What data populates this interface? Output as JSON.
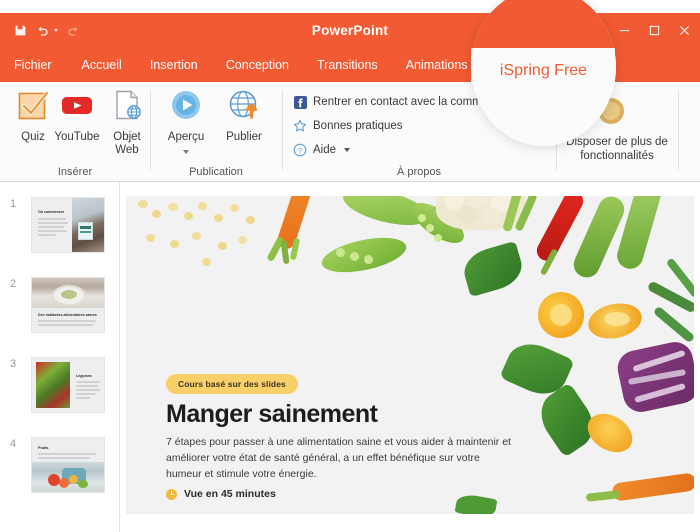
{
  "window": {
    "app_title": "PowerPoint",
    "quick_access": [
      {
        "name": "save-icon",
        "label": "Enregistrer"
      },
      {
        "name": "undo-icon",
        "label": "Annuler"
      },
      {
        "name": "redo-icon",
        "label": "Rétablir"
      }
    ],
    "controls": [
      {
        "name": "minimize-button",
        "glyph": "–"
      },
      {
        "name": "maximize-button",
        "glyph": "□"
      },
      {
        "name": "close-button",
        "glyph": "✕"
      }
    ]
  },
  "tabs": [
    {
      "label": "Fichier",
      "active": false
    },
    {
      "label": "Accueil",
      "active": false
    },
    {
      "label": "Insertion",
      "active": false
    },
    {
      "label": "Conception",
      "active": false
    },
    {
      "label": "Transitions",
      "active": false
    },
    {
      "label": "Animations",
      "active": false
    }
  ],
  "active_tab": {
    "label": "iSpring Free",
    "active": true
  },
  "ribbon": {
    "groups": [
      {
        "name": "inserer",
        "label": "Insérer",
        "buttons": [
          {
            "label": "Quiz",
            "icon": "quiz-checkbox-icon"
          },
          {
            "label": "YouTube",
            "icon": "youtube-icon"
          },
          {
            "label": "Objet Web",
            "icon": "web-object-icon"
          }
        ]
      },
      {
        "name": "publication",
        "label": "Publication",
        "buttons": [
          {
            "label": "Aperçu",
            "icon": "preview-play-icon",
            "has_dropdown": true
          },
          {
            "label": "Publier",
            "icon": "publish-globe-icon",
            "has_dropdown": false
          }
        ]
      },
      {
        "name": "a-propos",
        "label": "À propos",
        "links": [
          {
            "label": "Rentrer en contact avec la communauté",
            "icon": "facebook-icon"
          },
          {
            "label": "Bonnes pratiques",
            "icon": "star-icon"
          },
          {
            "label": "Aide",
            "icon": "help-circle-icon",
            "has_dropdown": true
          }
        ]
      },
      {
        "name": "promo",
        "label": "",
        "promo_text": "Disposer de plus de fonctionnalités"
      }
    ]
  },
  "thumbnails": [
    {
      "number": "1",
      "title": "Où commencer",
      "layout": "text-left-image-right"
    },
    {
      "number": "2",
      "title": "Des habitudes alimentaires saines",
      "layout": "image-top-text-bottom"
    },
    {
      "number": "3",
      "title": "Légumes",
      "layout": "image-left-text-right"
    },
    {
      "number": "4",
      "title": "Fruits",
      "layout": "text-top-image-bottom"
    }
  ],
  "slide": {
    "badge": "Cours basé sur des slides",
    "title": "Manger sainement",
    "body": "7 étapes pour passer à une alimentation saine et vous aider à maintenir et améliorer votre état de santé général, a un effet bénéfique sur votre humeur et stimule votre énergie.",
    "duration": "Vue en 45 minutes"
  },
  "colors": {
    "brand_orange": "#f15a33",
    "badge_yellow": "#f9cf6a",
    "slide_bg": "#f2f2f3",
    "ribbon_bg": "#fbfbfb"
  }
}
